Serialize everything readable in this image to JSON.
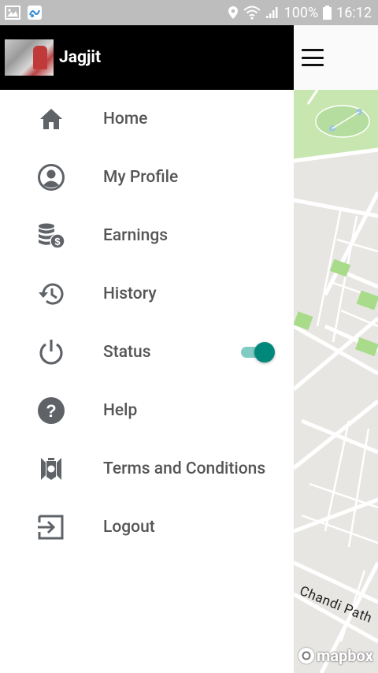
{
  "status_bar": {
    "battery_percent": "100%",
    "time": "16:12",
    "left_icons": [
      "image-icon",
      "app-icon"
    ],
    "right_icons": [
      "location-icon",
      "wifi-icon",
      "signal-icon",
      "battery-icon"
    ]
  },
  "drawer": {
    "user_name": "Jagjit",
    "menu": [
      {
        "label": "Home",
        "icon": "home-icon"
      },
      {
        "label": "My Profile",
        "icon": "profile-icon"
      },
      {
        "label": "Earnings",
        "icon": "earnings-icon"
      },
      {
        "label": "History",
        "icon": "history-icon"
      },
      {
        "label": "Status",
        "icon": "power-icon",
        "toggle_on": true
      },
      {
        "label": "Help",
        "icon": "help-icon"
      },
      {
        "label": "Terms and Conditions",
        "icon": "terms-icon"
      },
      {
        "label": "Logout",
        "icon": "logout-icon"
      }
    ]
  },
  "map": {
    "street_label": "Chandi Path",
    "attribution": "mapbox"
  },
  "colors": {
    "status_bar_bg": "#bdbdbd",
    "drawer_header_bg": "#000000",
    "menu_text": "#555555",
    "icon_color": "#5f6368",
    "toggle_thumb": "#00897b",
    "toggle_track": "#80cbc4",
    "map_green": "#c8e6b0"
  }
}
